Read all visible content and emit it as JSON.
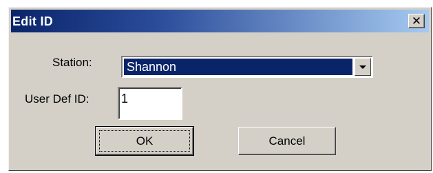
{
  "window": {
    "title": "Edit ID",
    "close_glyph": "✕"
  },
  "form": {
    "station_label": "Station:",
    "station_value": "Shannon",
    "user_def_label": "User Def ID:",
    "user_def_value": "1"
  },
  "buttons": {
    "ok": "OK",
    "cancel": "Cancel"
  },
  "icons": {
    "close": "close-icon",
    "dropdown": "chevron-down-icon"
  },
  "colors": {
    "titlebar_start": "#0a246a",
    "titlebar_end": "#a6caf0",
    "dialog_face": "#d4d0c8",
    "selection": "#0a246a"
  }
}
